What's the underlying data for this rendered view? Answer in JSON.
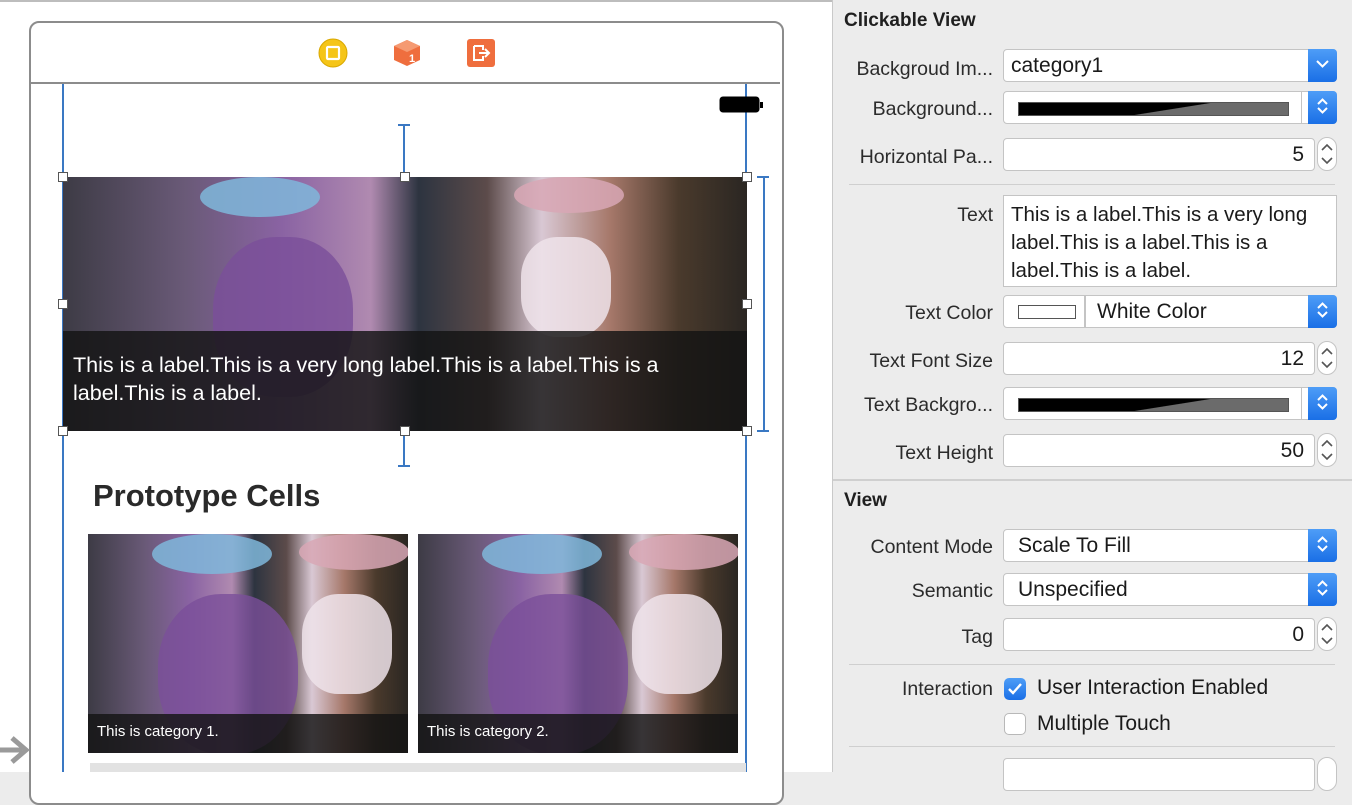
{
  "canvas": {
    "header_caption": "This is a label.This is a very long label.This is a label.This is a label.This is a label.",
    "section_title": "Prototype Cells",
    "cells": [
      {
        "caption": "This is category 1."
      },
      {
        "caption": "This is  category 2."
      }
    ],
    "dock_icons": [
      "view-controller-icon",
      "first-responder-icon",
      "exit-icon"
    ]
  },
  "inspector": {
    "clickable_view": {
      "title": "Clickable View",
      "background_image": {
        "label": "Backgroud Im...",
        "value": "category1"
      },
      "background_color": {
        "label": "Background..."
      },
      "horizontal_padding": {
        "label": "Horizontal Pa...",
        "value": "5"
      },
      "text": {
        "label": "Text",
        "value": "This is a label.This is a very long label.This is a label.This is a label.This is a label."
      },
      "text_color": {
        "label": "Text Color",
        "value": "White Color"
      },
      "text_font_size": {
        "label": "Text Font Size",
        "value": "12"
      },
      "text_background": {
        "label": "Text Backgro..."
      },
      "text_height": {
        "label": "Text Height",
        "value": "50"
      }
    },
    "view": {
      "title": "View",
      "content_mode": {
        "label": "Content Mode",
        "value": "Scale To Fill"
      },
      "semantic": {
        "label": "Semantic",
        "value": "Unspecified"
      },
      "tag": {
        "label": "Tag",
        "value": "0"
      },
      "interaction": {
        "label": "Interaction",
        "user_interaction_enabled": {
          "label": "User Interaction Enabled",
          "checked": true
        },
        "multiple_touch": {
          "label": "Multiple Touch",
          "checked": false
        }
      }
    }
  },
  "colors": {
    "accent": "#1a6fe6",
    "constraint_blue": "#3a78c3",
    "caption_bg": "#141414",
    "vc_icon_yellow": "#f5c518",
    "orange_icon": "#ef6e3e"
  }
}
